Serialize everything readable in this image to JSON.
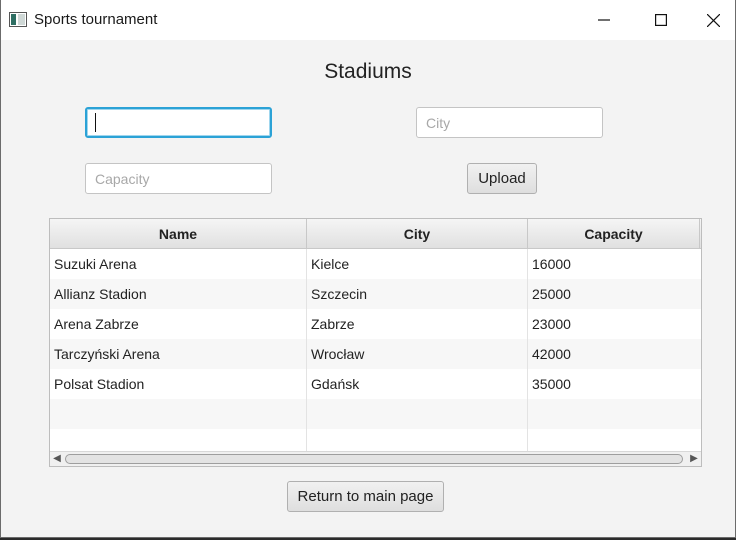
{
  "window": {
    "title": "Sports tournament",
    "controls": {
      "minimize": "minimize-icon",
      "maximize": "maximize-icon",
      "close": "close-icon"
    }
  },
  "page": {
    "heading": "Stadiums"
  },
  "form": {
    "name": {
      "value": "",
      "placeholder": ""
    },
    "city": {
      "value": "",
      "placeholder": "City"
    },
    "capacity": {
      "value": "",
      "placeholder": "Capacity"
    },
    "upload_label": "Upload"
  },
  "table": {
    "columns": [
      "Name",
      "City",
      "Capacity"
    ],
    "rows": [
      [
        "Suzuki Arena",
        "Kielce",
        "16000"
      ],
      [
        "Allianz Stadion",
        "Szczecin",
        "25000"
      ],
      [
        "Arena Zabrze",
        "Zabrze",
        "23000"
      ],
      [
        "Tarczyński Arena",
        "Wrocław",
        "42000"
      ],
      [
        "Polsat Stadion",
        "Gdańsk",
        "35000"
      ],
      [
        "",
        "",
        ""
      ],
      [
        "",
        "",
        ""
      ]
    ]
  },
  "footer": {
    "return_label": "Return to main page"
  },
  "colors": {
    "focus_accent": "#2ba2d6",
    "background": "#f3f3f3"
  }
}
